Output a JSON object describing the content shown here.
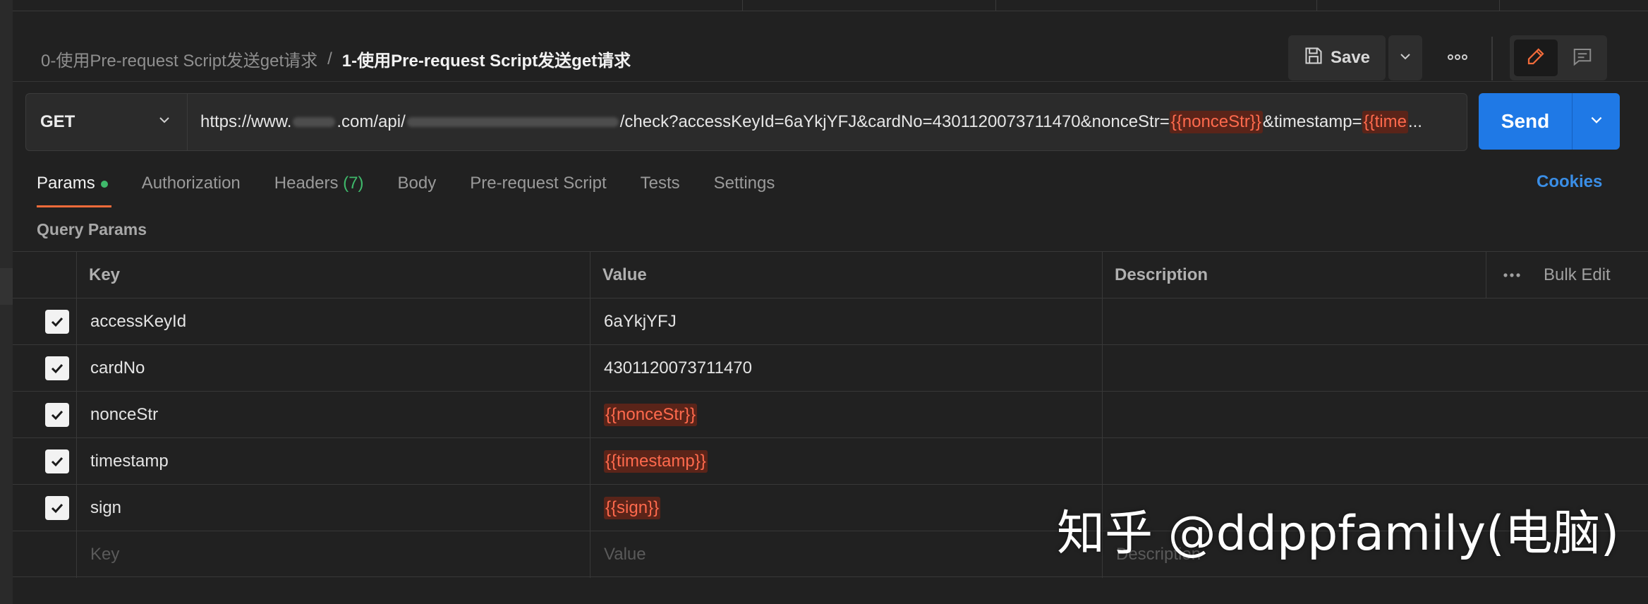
{
  "breadcrumb": {
    "parent": "0-使用Pre-request Script发送get请求",
    "separator": "/",
    "current": "1-使用Pre-request Script发送get请求"
  },
  "toolbar": {
    "save_label": "Save",
    "save_icon": "floppy-disk-icon",
    "more_icon": "ellipsis-icon",
    "edit_icon": "pencil-icon",
    "doc_icon": "comment-icon"
  },
  "request": {
    "method": "GET",
    "url_prefix": "https://www.",
    "url_part2": ".com/api/",
    "url_part3": "/check?accessKeyId=6aYkjYFJ&cardNo=4301120073711470&nonceStr=",
    "url_var1": "{{nonceStr}}",
    "url_part4": "&timestamp=",
    "url_var2": "{{time",
    "url_ellipsis": "...",
    "send_label": "Send"
  },
  "tabs": {
    "params": "Params",
    "authorization": "Authorization",
    "headers": "Headers",
    "headers_count": "(7)",
    "body": "Body",
    "prerequest": "Pre-request Script",
    "tests": "Tests",
    "settings": "Settings",
    "cookies": "Cookies"
  },
  "query_params": {
    "title": "Query Params",
    "columns": {
      "key": "Key",
      "value": "Value",
      "description": "Description",
      "bulk_edit": "Bulk Edit"
    },
    "rows": [
      {
        "key": "accessKeyId",
        "value": "6aYkjYFJ",
        "is_var": false,
        "checked": true
      },
      {
        "key": "cardNo",
        "value": "4301120073711470",
        "is_var": false,
        "checked": true
      },
      {
        "key": "nonceStr",
        "value": "{{nonceStr}}",
        "is_var": true,
        "checked": true
      },
      {
        "key": "timestamp",
        "value": "{{timestamp}}",
        "is_var": true,
        "checked": true
      },
      {
        "key": "sign",
        "value": "{{sign}}",
        "is_var": true,
        "checked": true
      }
    ],
    "placeholders": {
      "key": "Key",
      "value": "Value",
      "description": "Description"
    }
  },
  "watermark": "知乎 @ddppfamily(电脑)",
  "colors": {
    "accent_send": "#1f79e6",
    "active_tab_underline": "#f26b3a",
    "variable_text": "#ff6a4d",
    "variable_bg": "#5a2419",
    "status_dot": "#3fb96b",
    "cookies_link": "#3a8ee6"
  }
}
